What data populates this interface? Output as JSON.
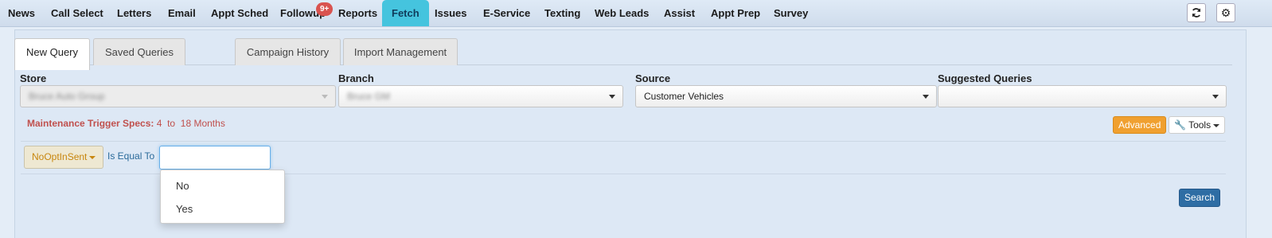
{
  "nav": {
    "items": [
      {
        "label": "News"
      },
      {
        "label": "Call Select"
      },
      {
        "label": "Letters"
      },
      {
        "label": "Email"
      },
      {
        "label": "Appt Sched"
      },
      {
        "label": "Followup",
        "badge": "9+"
      },
      {
        "label": "Reports"
      },
      {
        "label": "Fetch",
        "active": true
      },
      {
        "label": "Issues"
      },
      {
        "label": "E-Service"
      },
      {
        "label": "Texting"
      },
      {
        "label": "Web Leads"
      },
      {
        "label": "Assist"
      },
      {
        "label": "Appt Prep"
      },
      {
        "label": "Survey"
      }
    ],
    "refresh_icon": "refresh-icon",
    "settings_icon": "gear-icon"
  },
  "tabs": [
    "New Query",
    "Saved Queries",
    "Campaign History",
    "Import Management"
  ],
  "fields": {
    "store": {
      "label": "Store",
      "value": "Bruce Auto Group"
    },
    "branch": {
      "label": "Branch",
      "value": "Bruce GM"
    },
    "source": {
      "label": "Source",
      "value": "Customer Vehicles"
    },
    "suggested": {
      "label": "Suggested Queries",
      "value": ""
    }
  },
  "spec": {
    "label": "Maintenance Trigger Specs:",
    "from": "4",
    "to_word": "to",
    "to": "18 Months"
  },
  "buttons": {
    "advanced": "Advanced",
    "tools": "Tools",
    "search": "Search"
  },
  "filter": {
    "field": "NoOptInSent",
    "operator": "Is Equal To",
    "value": "",
    "options": [
      "No",
      "Yes"
    ]
  },
  "colors": {
    "active_tab": "#45c4de",
    "advanced": "#f0a030",
    "search": "#2e6da4",
    "spec": "#c0504d",
    "badge": "#d9534f"
  }
}
